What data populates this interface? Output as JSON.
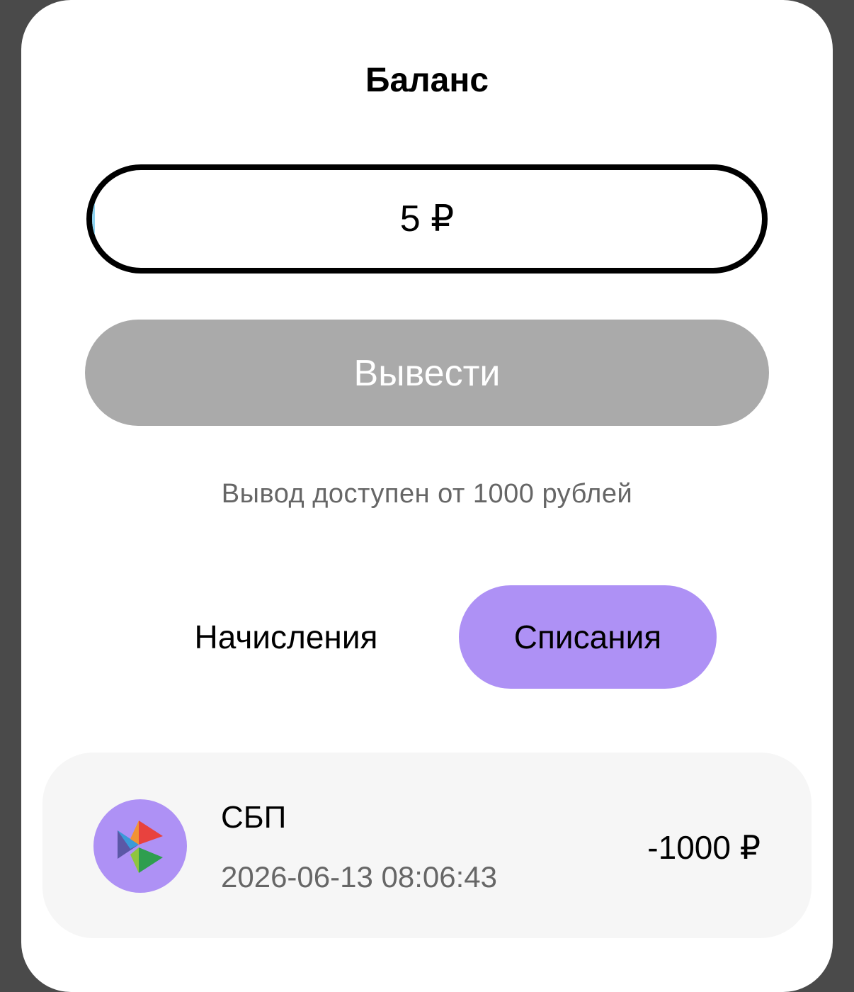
{
  "header": {
    "title": "Баланс"
  },
  "balance": {
    "value": "5 ₽"
  },
  "withdraw": {
    "label": "Вывести"
  },
  "hint": "Вывод доступен от 1000 рублей",
  "tabs": [
    {
      "label": "Начисления",
      "selected": false
    },
    {
      "label": "Списания",
      "selected": true
    }
  ],
  "transactions": [
    {
      "icon": "sbp-logo-icon",
      "title": "СБП",
      "date": "2026-06-13 08:06:43",
      "amount": "-1000 ₽"
    }
  ],
  "colors": {
    "accent": "#ae91f5",
    "button_disabled": "#aaaaaa",
    "card_bg": "#f6f6f6",
    "backdrop": "#4a4a4a"
  }
}
